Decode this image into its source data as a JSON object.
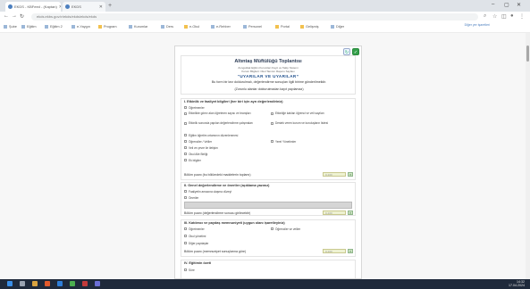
{
  "browser": {
    "tabs": [
      {
        "label": "EKDS - KBFeed - (Kaptan)"
      },
      {
        "label": "EKDS"
      }
    ],
    "new_tab": "+",
    "url": "ekds.ekbs.gov.tr/ekds/ekds/ekds/ekds",
    "window_controls": {
      "minimize": "–",
      "maximize": "▢",
      "close": "✕"
    }
  },
  "bookmarks": [
    {
      "label": "Şube",
      "type": "page"
    },
    {
      "label": "Eğitim",
      "type": "page"
    },
    {
      "label": "Eğitim 2",
      "type": "page"
    },
    {
      "label": "e-Yaygın",
      "type": "page"
    },
    {
      "label": "Program",
      "type": "folder"
    },
    {
      "label": "Kurumlar",
      "type": "page"
    },
    {
      "label": "Ders",
      "type": "page"
    },
    {
      "label": "e-Okul",
      "type": "folder"
    },
    {
      "label": "e-Rehber",
      "type": "page"
    },
    {
      "label": "Personel",
      "type": "page"
    },
    {
      "label": "Portal",
      "type": "folder"
    },
    {
      "label": "Gelişmiş",
      "type": "folder"
    },
    {
      "label": "Diğer",
      "type": "page"
    }
  ],
  "bookmarks_right": "Diğer yer işaretleri",
  "document": {
    "title": "Altıntaş Müftülüğü Toplantısı",
    "sub_lines": [
      "Zonguldak Eğitim Kurumları Kayıt ve Takip Sistemi",
      "Kurum Bilgileri: Okul Tanıtım Raporu Sayfası"
    ],
    "main_heading": "“UYARILAR VE UYARILAR”",
    "intro_lines": [
      "Bu form bir kez doldurulmalı, değerlendirme sonuçları ilgili birime gönderilmelidir.",
      "(Zorunlu alanlar doldurulmadan kayıt yapılamaz)"
    ],
    "sections": [
      {
        "title": "I. Etkinlik ve faaliyet bilgileri (her biri için ayrı değerlendiriniz)",
        "options": [
          "Öğretmenler",
          "Öğrenciler / Veliler",
          "Okul Aile Birliği",
          "Yerel Yönetimler"
        ],
        "long_options": [
          "Etkinlikte görev alan öğretmen sayısı ve branşları",
          "Etkinliğe katılan öğrenci ve veli sayıları",
          "Etkinlik sonunda yapılan değerlendirme çalışmaları",
          "Destek veren kurum ve kuruluşların listesi"
        ],
        "extra": [
          "Eğitim öğretim ortamının düzenlenmesi",
          "Veli ve çevre ile iletişim",
          "Ek bilgiler"
        ],
        "score_label": "Bölüm puanı (bu bölümdeki maddelerin toplamı)",
        "score_placeholder": "0-100"
      },
      {
        "title": "II. Genel değerlendirme ve öneriler (açıklama yazınız)",
        "options": [
          "Faaliyetin amacına ulaşma düzeyi",
          "Öneriler"
        ],
        "score_label": "Bölüm puanı (değerlendirme sonucu girilecektir)",
        "score_placeholder": "0-100"
      },
      {
        "title": "III. Katılımcı ve paydaş memnuniyeti (uygun olanı işaretleyiniz)",
        "options": [
          "Öğretmenler",
          "Öğrenciler ve veliler",
          "Okul yönetimi",
          "Diğer paydaşlar"
        ],
        "score_label": "Bölüm puanı (memnuniyet sonuçlarına göre)",
        "score_placeholder": "0-100"
      },
      {
        "title": "IV. Eğitimin özeti",
        "options": [
          "Süre"
        ]
      }
    ]
  },
  "taskbar": {
    "time": "14:32",
    "date": "17.04.2024"
  }
}
